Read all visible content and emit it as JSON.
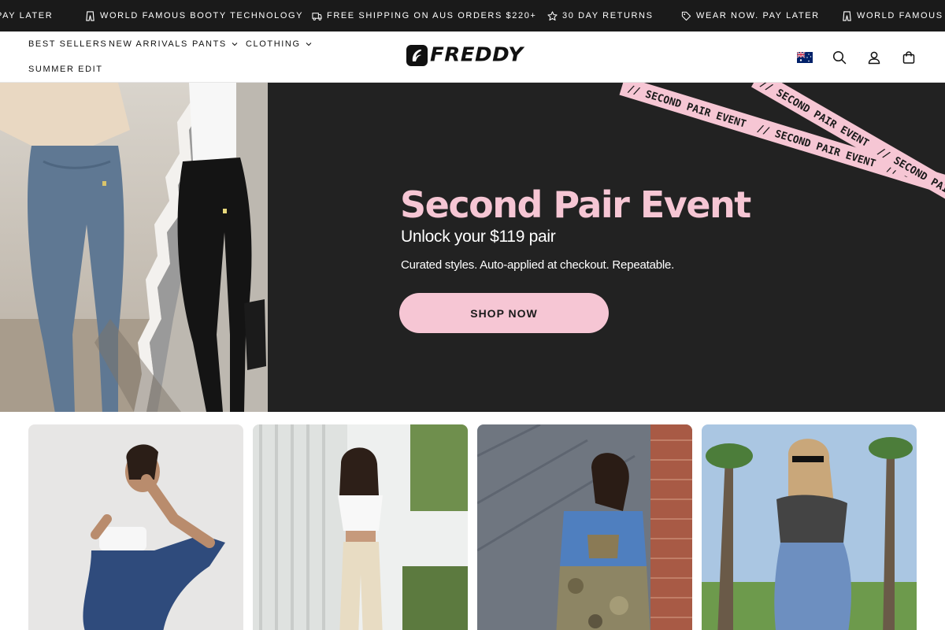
{
  "announcement": {
    "items": [
      {
        "text": "PAY LATER",
        "icon": "tag-icon"
      },
      {
        "text": "WORLD FAMOUS BOOTY TECHNOLOGY",
        "icon": "jeans-icon"
      },
      {
        "text": "FREE SHIPPING ON AUS ORDERS $220+",
        "icon": "truck-icon"
      },
      {
        "text": "30 DAY RETURNS",
        "icon": "star-icon"
      },
      {
        "text": "WEAR NOW. PAY LATER",
        "icon": "tag-icon"
      },
      {
        "text": "WORLD FAMOUS BOO",
        "icon": "jeans-icon"
      }
    ]
  },
  "nav": {
    "best_sellers": "BEST SELLERS",
    "new_arrivals": "NEW ARRIVALS",
    "pants": "PANTS",
    "clothing": "CLOTHING",
    "summer_edit": "SUMMER EDIT"
  },
  "logo": {
    "text": "FREDDY"
  },
  "header_icons": [
    "australia-flag-icon",
    "search-icon",
    "account-icon",
    "cart-icon"
  ],
  "hero": {
    "ribbon_text": "// SECOND PAIR EVENT",
    "title": "Second Pair Event",
    "subtitle": "Unlock your $119 pair",
    "description": "Curated styles. Auto-applied at checkout. Repeatable.",
    "button": "SHOP NOW"
  },
  "colors": {
    "announcement_bg": "#1a1a1a",
    "hero_bg": "#222222",
    "accent_pink": "#f6c6d4"
  },
  "product_cards": [
    {
      "name": "flare-denim-white-top"
    },
    {
      "name": "beige-pants-white-shirt"
    },
    {
      "name": "camo-pants-denim-jacket"
    },
    {
      "name": "blue-jeans-gingham-top"
    }
  ]
}
